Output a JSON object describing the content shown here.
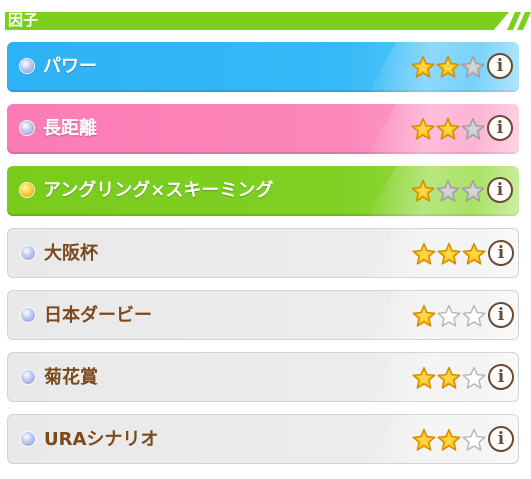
{
  "header": {
    "title": "因子"
  },
  "colors": {
    "accent_green": "#7ccf1c",
    "blue": "#2fb2f5",
    "pink": "#fb7cb4",
    "green": "#7ccf1c",
    "gray": "#eaeaea",
    "text_brown": "#7a4a1e",
    "star_filled": "#ffc20e",
    "star_gray": "#c0c0c0"
  },
  "factors": [
    {
      "name": "パワー",
      "stars": 2,
      "max_stars": 3,
      "style": "blue",
      "dot": "blue-dot-icon"
    },
    {
      "name": "長距離",
      "stars": 2,
      "max_stars": 3,
      "style": "pink",
      "dot": "blue-dot-icon"
    },
    {
      "name": "アングリング×スキーミング",
      "stars": 1,
      "max_stars": 3,
      "style": "green",
      "dot": "gold-dot-icon"
    },
    {
      "name": "大阪杯",
      "stars": 3,
      "max_stars": 3,
      "style": "gray",
      "dot": "blue-dot-icon"
    },
    {
      "name": "日本ダービー",
      "stars": 1,
      "max_stars": 3,
      "style": "gray",
      "dot": "blue-dot-icon"
    },
    {
      "name": "菊花賞",
      "stars": 2,
      "max_stars": 3,
      "style": "gray",
      "dot": "blue-dot-icon"
    },
    {
      "name": "URAシナリオ",
      "stars": 2,
      "max_stars": 3,
      "style": "gray",
      "dot": "blue-dot-icon"
    }
  ],
  "info_button": {
    "glyph": "i",
    "icon": "info-icon"
  }
}
